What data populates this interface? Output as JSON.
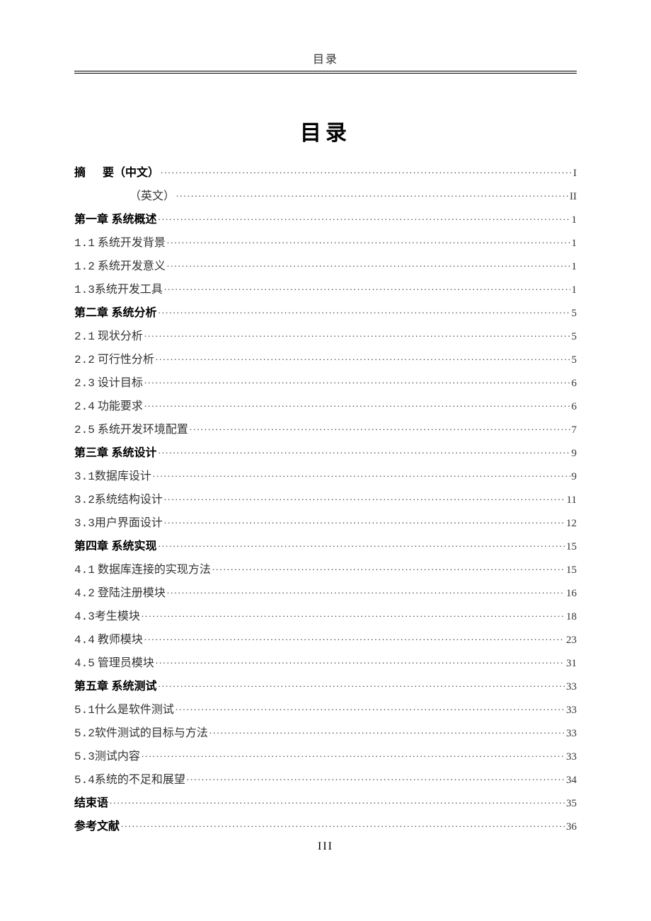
{
  "header": "目录",
  "title": "目录",
  "footer": "III",
  "toc": [
    {
      "label_prefix": "摘",
      "label_gap": true,
      "label": "要（中文）",
      "page": "I",
      "bold": true,
      "indent": "indent-abstract"
    },
    {
      "label": "（英文）",
      "page": "II",
      "bold": false,
      "indent": "indent-abstract2"
    },
    {
      "label": "第一章  系统概述",
      "page": "1",
      "bold": true
    },
    {
      "num": "1.1",
      "label": "系统开发背景",
      "page": "1"
    },
    {
      "num": "1.2",
      "label": "系统开发意义",
      "page": "1"
    },
    {
      "num": "1.3",
      "label": "系统开发工具",
      "page": "1",
      "tight": true
    },
    {
      "label": "第二章  系统分析",
      "page": "5",
      "bold": true
    },
    {
      "num": "2.1",
      "label": "现状分析",
      "page": "5"
    },
    {
      "num": "2.2",
      "label": "可行性分析",
      "page": "5"
    },
    {
      "num": "2.3",
      "label": "设计目标",
      "page": "6"
    },
    {
      "num": "2.4",
      "label": "功能要求",
      "page": "6"
    },
    {
      "num": "2.5",
      "label": "系统开发环境配置",
      "page": "7"
    },
    {
      "label": "第三章  系统设计",
      "page": "9",
      "bold": true
    },
    {
      "num": "3.1",
      "label": "数据库设计",
      "page": "9",
      "tight": true
    },
    {
      "num": "3.2",
      "label": "系统结构设计",
      "page": "11",
      "tight": true
    },
    {
      "num": "3.3",
      "label": "用户界面设计",
      "page": "12",
      "tight": true
    },
    {
      "label": "第四章  系统实现",
      "page": "15",
      "bold": true
    },
    {
      "num": "4.1",
      "label": "数据库连接的实现方法",
      "page": "15"
    },
    {
      "num": "4.2",
      "label": "登陆注册模块",
      "page": "16"
    },
    {
      "num": "4.3",
      "label": "考生模块",
      "page": "18",
      "tight": true
    },
    {
      "num": "4.4",
      "label": "教师模块",
      "page": "23"
    },
    {
      "num": "4.5",
      "label": "管理员模块",
      "page": "31"
    },
    {
      "label": "第五章  系统测试",
      "page": "33",
      "bold": true
    },
    {
      "num": "5.1",
      "label": "什么是软件测试",
      "page": "33",
      "tight": true
    },
    {
      "num": "5.2",
      "label": "软件测试的目标与方法",
      "page": "33",
      "tight": true
    },
    {
      "num": "5.3",
      "label": "测试内容",
      "page": "33",
      "tight": true
    },
    {
      "num": "5.4",
      "label": "系统的不足和展望",
      "page": "34",
      "tight": true
    },
    {
      "label": "结束语",
      "page": "35",
      "bold": true
    },
    {
      "label": "参考文献",
      "page": "36",
      "bold": true
    }
  ]
}
